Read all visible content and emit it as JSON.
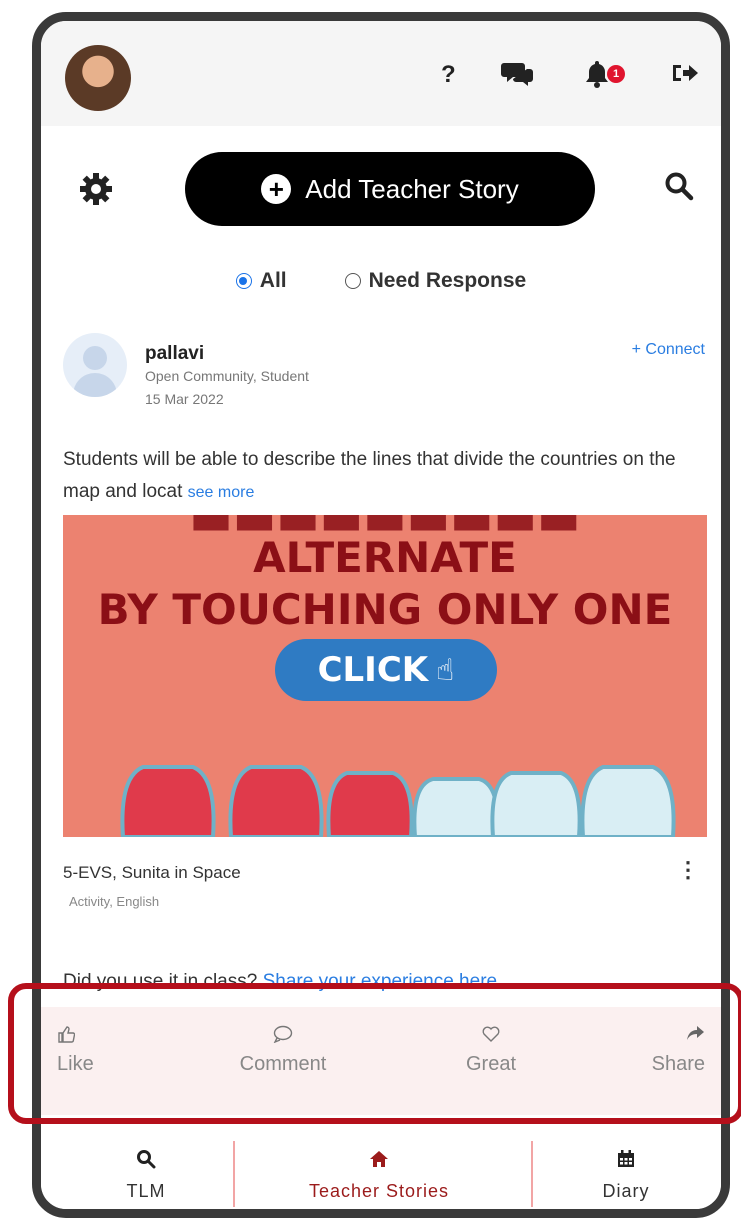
{
  "header": {
    "help_icon_glyph": "?",
    "chat_icon_glyph": "💬",
    "bell_icon_glyph": "🔔",
    "logout_icon_glyph": "⇥",
    "notification_count": "1"
  },
  "toolbar": {
    "settings_icon": "gear-icon",
    "add_story_label": "Add Teacher Story",
    "search_icon": "search-icon"
  },
  "filters": {
    "options": [
      "All",
      "Need Response"
    ],
    "selected": "All"
  },
  "post": {
    "author": "pallavi",
    "author_meta": "Open Community, Student",
    "date": "15 Mar 2022",
    "connect_label": "+ Connect",
    "description": "Students will be able to describe the lines that divide the countries on the map and locat",
    "see_more": "see more",
    "media": {
      "line1": "ALTERNATE",
      "line2": "BY TOUCHING ONLY ONE",
      "button": "CLICK"
    },
    "title": "5-EVS, Sunita in Space",
    "tags": "Activity, English",
    "prompt": "Did you use it in class?",
    "prompt_link": "Share your experience here"
  },
  "actions": {
    "like": "Like",
    "comment": "Comment",
    "great": "Great",
    "share": "Share"
  },
  "bottom_nav": {
    "tlm": "TLM",
    "stories": "Teacher Stories",
    "diary": "Diary",
    "active": "Teacher Stories"
  },
  "colors": {
    "accent": "#9b1b1b",
    "link": "#2a7de1",
    "highlight_border": "#b50f1b",
    "media_bg": "#ec8270"
  }
}
